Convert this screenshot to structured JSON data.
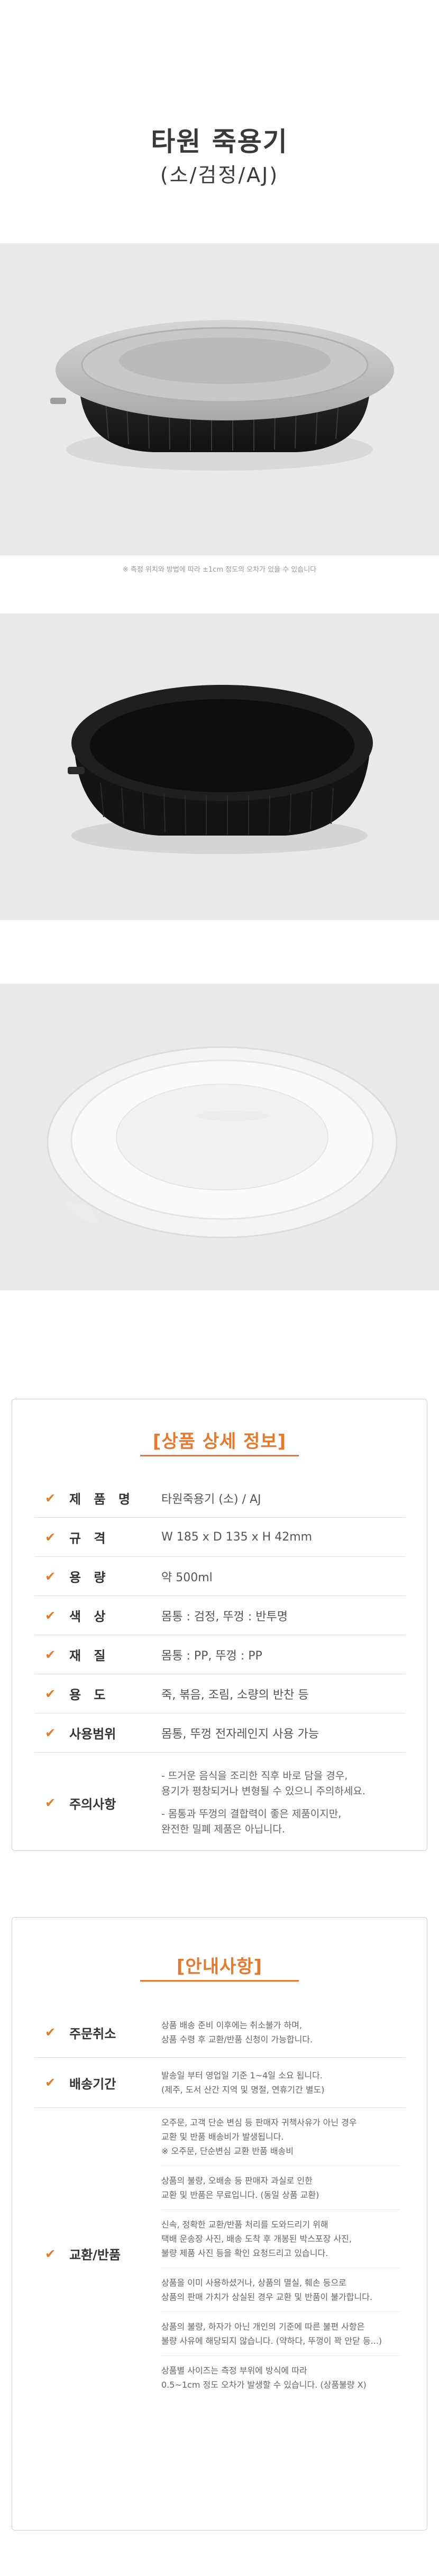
{
  "header": {
    "title": "타원 죽용기",
    "subtitle": "(소/검정/AJ)"
  },
  "photo_note": "※ 측정 위치와 방법에 따라 ±1cm 정도의 오차가 있을 수 있습니다",
  "colors": {
    "accent": "#e8782d",
    "panel_bg": "#e9e9e9",
    "container_black": "#1c1c1c",
    "lid_gray": "#bdbdbd"
  },
  "product_info": {
    "title": "[상품 상세 정보]",
    "rows": [
      {
        "key": "제 품 명",
        "value": "타원죽용기 (소) / AJ"
      },
      {
        "key": "규 격",
        "value": "W 185 x D 135 x H 42mm"
      },
      {
        "key": "용 량",
        "value": "약 500ml"
      },
      {
        "key": "색 상",
        "value": "몸통 : 검정,  뚜껑 : 반투명"
      },
      {
        "key": "재 질",
        "value": "몸통 : PP,  뚜껑 : PP"
      },
      {
        "key": "용 도",
        "value": "죽, 볶음, 조림, 소량의 반찬 등"
      },
      {
        "key": "사용범위",
        "value": "몸통, 뚜껑 전자레인지 사용 가능"
      }
    ],
    "caution": {
      "key": "주의사항",
      "lines_1": [
        "- 뜨거운 음식을 조리한 직후 바로 담을 경우,",
        "  용기가 평창되거나 변형될 수 있으니 주의하세요."
      ],
      "lines_2": [
        "- 몸통과 뚜껑의 결합력이 좋은 제품이지만,",
        "  완전한 밀폐 제품은 아닙니다."
      ]
    }
  },
  "notice": {
    "title": "[안내사항]",
    "cancel": {
      "key": "주문취소",
      "lines": [
        "상품 배송 준비 이후에는 취소불가 하며,",
        "상품 수령 후 교환/반품 신청이 가능합니다."
      ]
    },
    "shipping": {
      "key": "배송기간",
      "lines": [
        "발송일 부터 영업일 기준 1~4일 소요 됩니다.",
        "(제주, 도서 산간 지역 및 명절, 연휴기간 별도)"
      ]
    },
    "returns": {
      "key": "교환/반품",
      "blocks": [
        [
          "오주문, 고객 단순 변심 등 판매자 귀책사유가 아닌 경우",
          "교환 및 반품 배송비가 발생됩니다.",
          "※ 오주문, 단순변심 교환 반품 배송비"
        ],
        [
          "상품의 불량, 오배송 등 판매자 과실로 인한",
          "교환 및 반품은 무료입니다. (동일 상품 교환)"
        ],
        [
          "신속, 정확한 교환/반품 처리를 도와드리기 위해",
          "택배 운송장 사진, 배송 도착 후 개봉된 박스포장 사진,",
          "불량 제품 사진 등을 확인 요청드리고 있습니다."
        ],
        [
          "상품을 이미 사용하셨거나, 상품의 멸실, 훼손 등으로",
          "상품의 판매 가치가 상실된 경우 교환 및 반품이 불가합니다."
        ],
        [
          "상품의 불량, 하자가 아닌 개인의 기준에 따른 불편 사항은",
          "불량 사유에 해당되지 않습니다. (약하다, 뚜껑이 꽉 안닫 등...)"
        ],
        [
          "상품별 사이즈는 측정 부위에 방식에 따라",
          "0.5~1cm 정도 오차가 발생할 수 있습니다. (상품불량 X)"
        ]
      ]
    }
  }
}
